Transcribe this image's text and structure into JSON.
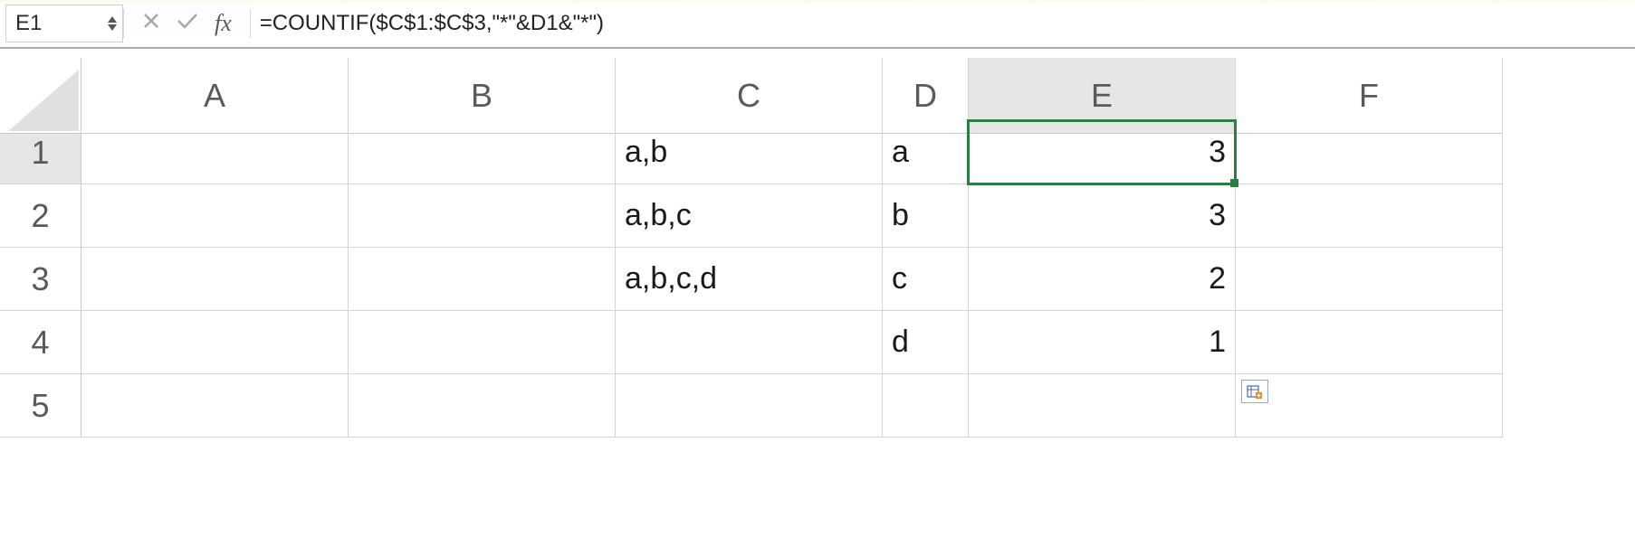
{
  "formula_bar": {
    "name_box": "E1",
    "formula": "=COUNTIF($C$1:$C$3,\"*\"&D1&\"*\")",
    "fx_label": "fx"
  },
  "columns": [
    "A",
    "B",
    "C",
    "D",
    "E",
    "F"
  ],
  "rows": [
    "1",
    "2",
    "3",
    "4",
    "5"
  ],
  "selected": {
    "col": "E",
    "row": "1"
  },
  "cells": {
    "C1": "a,b",
    "C2": "a,b,c",
    "C3": "a,b,c,d",
    "D1": "a",
    "D2": "b",
    "D3": "c",
    "D4": "d",
    "E1": "3",
    "E2": "3",
    "E3": "2",
    "E4": "1"
  }
}
